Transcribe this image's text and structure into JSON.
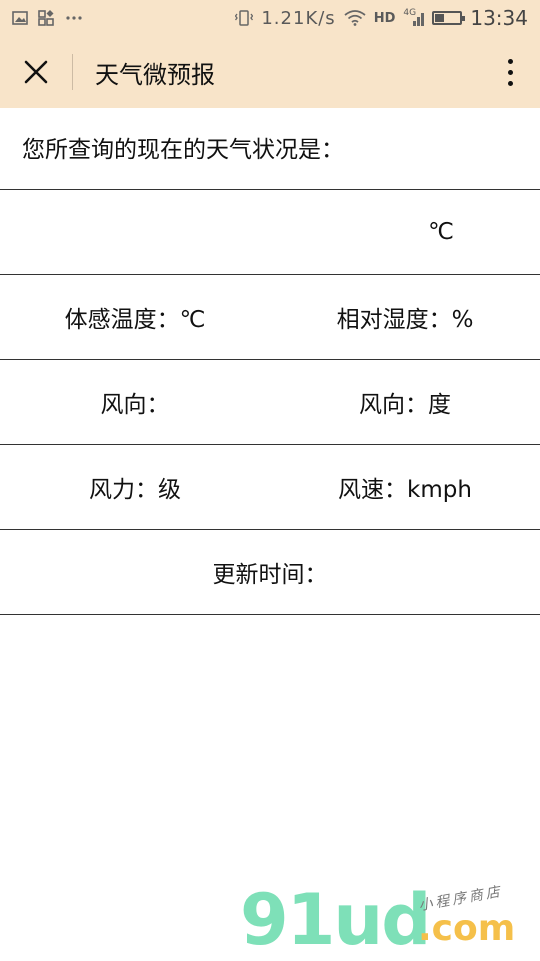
{
  "status_bar": {
    "network_speed": "1.21K/s",
    "network_type": "HD",
    "signal_label": "4G",
    "time": "13:34",
    "battery_level": 0.35,
    "icons": [
      "image-icon",
      "app-grid-icon",
      "more-dots-icon",
      "vibrate-icon",
      "wifi-icon",
      "signal-icon",
      "battery-icon"
    ]
  },
  "nav": {
    "title": "天气微预报",
    "close_icon": "close-icon",
    "menu_icon": "more-vertical-icon",
    "accent_color": "#f8e4c9"
  },
  "weather": {
    "question": "您所查询的现在的天气状况是：",
    "temperature": "℃",
    "feels_like": "体感温度：℃",
    "humidity": "相对湿度：%",
    "wind_direction": "风向：",
    "wind_degree": "风向：度",
    "wind_force": "风力：级",
    "wind_speed": "风速：kmph",
    "update_time": "更新时间："
  },
  "watermark": {
    "brand": "91ud",
    "suffix": ".com",
    "tagline": "小程序商店"
  }
}
